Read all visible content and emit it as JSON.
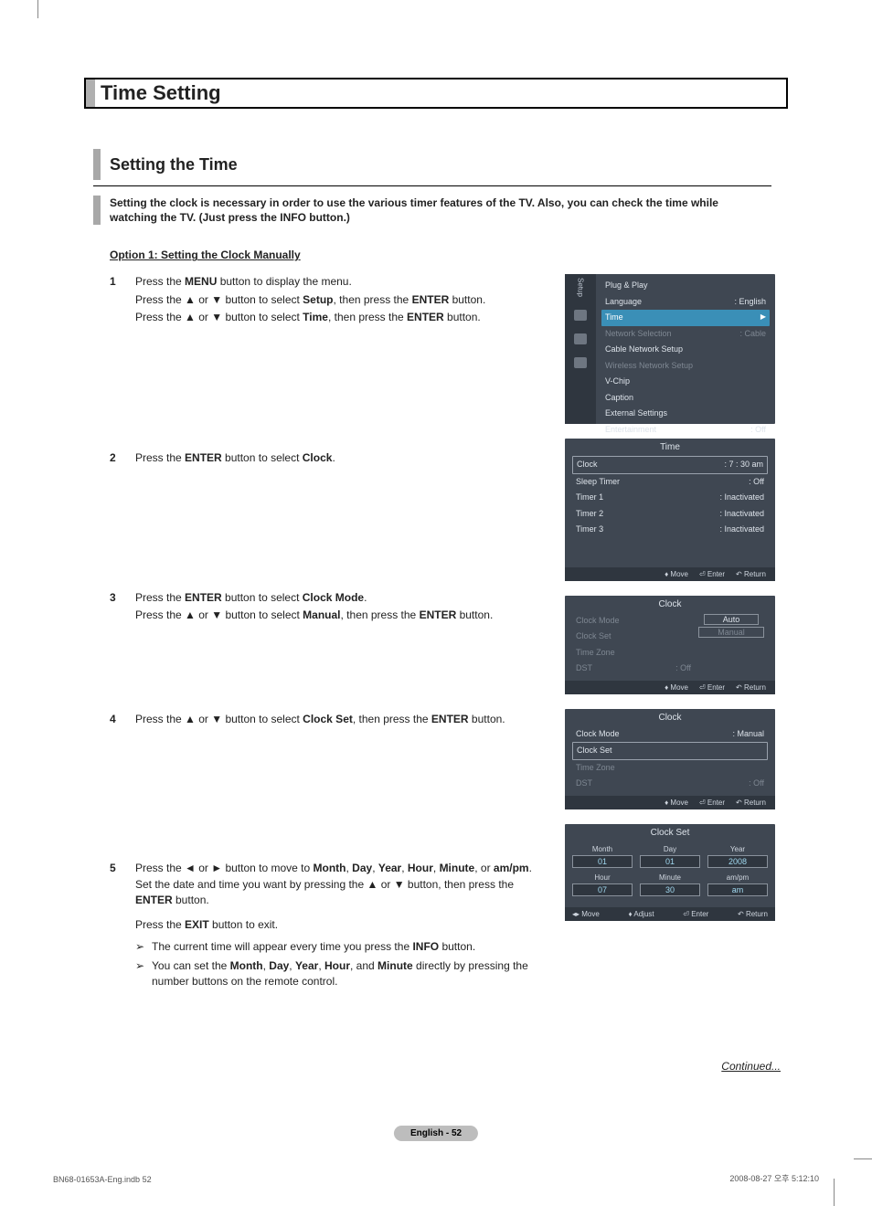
{
  "title": "Time Setting",
  "section_title": "Setting the Time",
  "intro": "Setting the clock is necessary in order to use the various timer features of the TV. Also, you can check the time while watching the TV. (Just press the INFO button.)",
  "option1_head": "Option 1: Setting the Clock Manually",
  "steps": {
    "s1": {
      "num": "1",
      "l1a": "Press the ",
      "l1b": "MENU",
      "l1c": " button to display the menu.",
      "l2a": "Press the ▲ or ▼ button to select ",
      "l2b": "Setup",
      "l2c": ", then press the ",
      "l2d": "ENTER",
      "l2e": " button.",
      "l3a": "Press the ▲ or ▼ button to select ",
      "l3b": "Time",
      "l3c": ", then press the ",
      "l3d": "ENTER",
      "l3e": " button."
    },
    "s2": {
      "num": "2",
      "a": "Press the ",
      "b": "ENTER",
      "c": " button to select ",
      "d": "Clock",
      "e": "."
    },
    "s3": {
      "num": "3",
      "l1a": "Press the ",
      "l1b": "ENTER",
      "l1c": " button to select ",
      "l1d": "Clock Mode",
      "l1e": ".",
      "l2a": "Press the ▲ or ▼ button to select ",
      "l2b": "Manual",
      "l2c": ", then press the ",
      "l2d": "ENTER",
      "l2e": " button."
    },
    "s4": {
      "num": "4",
      "a": "Press the ▲ or ▼ button to select ",
      "b": "Clock Set",
      "c": ", then press the ",
      "d": "ENTER",
      "e": " button."
    },
    "s5": {
      "num": "5",
      "l1a": "Press the ◄ or ► button to move to ",
      "l1b": "Month",
      "l1c": ", ",
      "l1d": "Day",
      "l1e": ", ",
      "l1f": "Year",
      "l1g": ", ",
      "l1h": "Hour",
      "l1i": ", ",
      "l1j": "Minute",
      "l1k": ", or ",
      "l1l": "am/pm",
      "l1m": ". Set the date and time you want by pressing the ▲ or ▼ button, then press the ",
      "l1n": "ENTER",
      "l1o": " button.",
      "l2a": "Press the ",
      "l2b": "EXIT",
      "l2c": " button to exit.",
      "b1a": "The current time will appear every time you press the ",
      "b1b": "INFO",
      "b1c": " button.",
      "b2a": "You can set the ",
      "b2b": "Month",
      "b2c": ", ",
      "b2d": "Day",
      "b2e": ", ",
      "b2f": "Year",
      "b2g": ", ",
      "b2h": "Hour",
      "b2i": ", and ",
      "b2j": "Minute",
      "b2k": " directly by pressing the number buttons on the remote control."
    }
  },
  "osd_setup": {
    "sidebar": "Setup",
    "rows": [
      {
        "label": "Plug & Play",
        "value": ""
      },
      {
        "label": "Language",
        "value": ": English"
      },
      {
        "label": "Time",
        "value": "",
        "sel": true
      },
      {
        "label": "Network Selection",
        "value": ": Cable",
        "dim": true
      },
      {
        "label": "Cable Network Setup",
        "value": ""
      },
      {
        "label": "Wireless Network Setup",
        "value": "",
        "dim": true
      },
      {
        "label": "V-Chip",
        "value": ""
      },
      {
        "label": "Caption",
        "value": ""
      },
      {
        "label": "External Settings",
        "value": ""
      },
      {
        "label": "Entertainment",
        "value": ": Off"
      }
    ]
  },
  "osd_time": {
    "title": "Time",
    "rows": [
      {
        "label": "Clock",
        "value": ":  7 : 30 am",
        "box": true
      },
      {
        "label": "Sleep Timer",
        "value": ": Off"
      },
      {
        "label": "Timer 1",
        "value": ": Inactivated"
      },
      {
        "label": "Timer 2",
        "value": ": Inactivated"
      },
      {
        "label": "Timer 3",
        "value": ": Inactivated"
      }
    ],
    "foot": {
      "move": "Move",
      "enter": "Enter",
      "return": "Return"
    }
  },
  "osd_clock1": {
    "title": "Clock",
    "left": [
      "Clock Mode",
      "Clock Set",
      "Time Zone",
      "DST"
    ],
    "dst_val": ": Off",
    "opts": [
      "Auto",
      "Manual"
    ],
    "foot": {
      "move": "Move",
      "enter": "Enter",
      "return": "Return"
    }
  },
  "osd_clock2": {
    "title": "Clock",
    "rows": [
      {
        "label": "Clock Mode",
        "value": ": Manual"
      },
      {
        "label": "Clock Set",
        "value": "",
        "box": true
      },
      {
        "label": "Time Zone",
        "value": "",
        "dim": true
      },
      {
        "label": "DST",
        "value": ": Off",
        "dim": true
      }
    ],
    "foot": {
      "move": "Move",
      "enter": "Enter",
      "return": "Return"
    }
  },
  "osd_clockset": {
    "title": "Clock Set",
    "row1": [
      {
        "lab": "Month",
        "val": "01"
      },
      {
        "lab": "Day",
        "val": "01"
      },
      {
        "lab": "Year",
        "val": "2008"
      }
    ],
    "row2": [
      {
        "lab": "Hour",
        "val": "07"
      },
      {
        "lab": "Minute",
        "val": "30"
      },
      {
        "lab": "am/pm",
        "val": "am"
      }
    ],
    "foot": {
      "move": "Move",
      "adjust": "Adjust",
      "enter": "Enter",
      "return": "Return"
    }
  },
  "continued": "Continued...",
  "page_pill": "English - 52",
  "footer_left": "BN68-01653A-Eng.indb   52",
  "footer_right": "2008-08-27   오후 5:12:10"
}
